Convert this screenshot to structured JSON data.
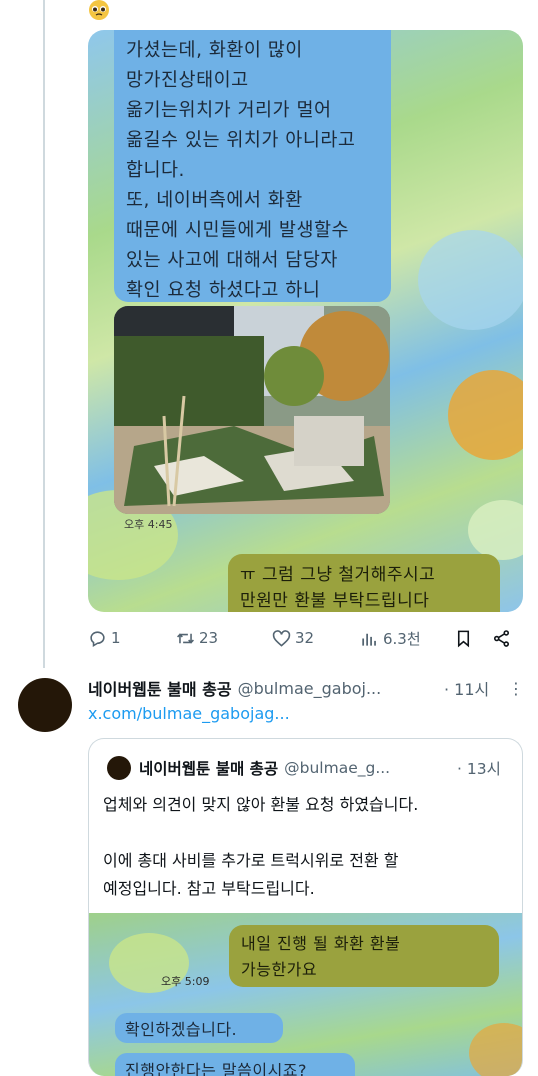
{
  "tweet1": {
    "chat_message_1": "가셨는데, 화환이 많이\n망가진상태이고\n옮기는위치가 거리가 멀어\n옮길수 있는 위치가 아니라고\n합니다.\n또, 네이버측에서 화환\n때문에 시민들에게 발생할수\n있는 사고에 대해서 담당자\n확인 요청 하셨다고 하니\n재설치는 어려울거 같습니다.",
    "photo_time": "오후 4:45",
    "chat_message_2": "ㅠ 그럼 그냥 철거해주시고\n만원만 환불 부탁드립니다",
    "replies": "1",
    "retweets": "23",
    "likes": "32",
    "views": "6.3천"
  },
  "tweet2": {
    "display_name": "네이버웹툰 불매 총공",
    "handle": "@bulmae_gaboj...",
    "time": "· 11시",
    "link": "x.com/bulmae_gabojag...",
    "quote": {
      "display_name": "네이버웹툰 불매 총공",
      "handle": "@bulmae_g...",
      "time": "· 13시",
      "text": "업체와 의견이 맞지 않아 환불 요청 하였습니다.\n\n이에 총대 사비를 추가로 트럭시위로 전환 할\n예정입니다. 참고 부탁드립니다.",
      "chat_message_1": "내일 진행 될 화환 환불\n가능한가요",
      "chat_time": "오후 5:09",
      "chat_message_2": "확인하겠습니다.",
      "chat_message_3": "진행안한다는 말씀이시죠?"
    }
  },
  "colors": {
    "link_blue": "#1d9bf0",
    "muted_gray": "#536471",
    "chat_blue": "#6fb1e6",
    "chat_olive": "#9aa23e"
  },
  "icons": [
    "reply-icon",
    "retweet-icon",
    "like-icon",
    "views-icon",
    "bookmark-icon",
    "share-icon",
    "more-icon",
    "pleading-face-emoji"
  ]
}
